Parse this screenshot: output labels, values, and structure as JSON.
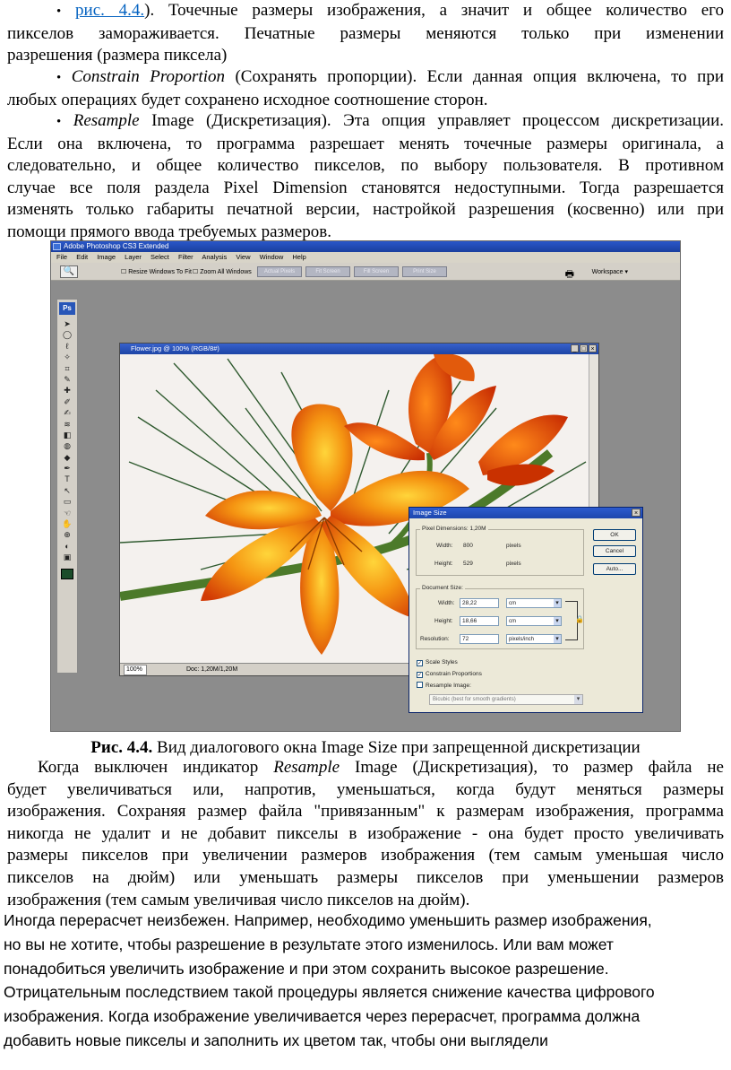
{
  "text": {
    "bullet_symbol": "•",
    "p1_link": "рис. 4.4.",
    "p1_l1_rest": "). Точечные размеры изображения, а значит и общее количество его",
    "p1_l2": "пикселов замораживается. Печатные размеры меняются только при изменении",
    "p1_l3": "разрешения (размера пиксела)",
    "p2_term": "Constrain Proportion",
    "p2_l1_rest": " (Сохранять пропорции). Если данная опция включена, то при",
    "p2_l2": "любых операциях будет сохранено исходное соотношение сторон.",
    "p3_term": "Resample",
    "p3_l1_rest": " Image (Дискретизация). Эта опция управляет процессом дискретизации.",
    "p3_l2": "Если она включена, то программа разрешает менять точечные размеры оригинала, а",
    "p3_l3": "следовательно, и общее количество пикселов, по выбору пользователя. В противном",
    "p3_l4": "случае все поля раздела Pixel Dimension становятся недоступными. Тогда разрешается",
    "p3_l5": "изменять только габариты печатной версии, настройкой разрешения (косвенно) или при",
    "p3_l6": "помощи прямого ввода требуемых размеров.",
    "caption_label": "Рис. 4.4.",
    "caption_text": " Вид диалогового окна Image Size при запрещенной дискретизации",
    "p4_l1_a": "Когда выключен индикатор ",
    "p4_term": "Resample",
    "p4_l1_b": " Image (Дискретизация), то размер файла не",
    "p4_l2": "будет увеличиваться или, напротив, уменьшаться, когда будут меняться размеры",
    "p4_l3": "изображения. Сохраняя размер файла \"привязанным\" к размерам изображения, программа",
    "p4_l4": "никогда не удалит и не добавит пикселы в изображение - она будет просто увеличивать",
    "p4_l5": "размеры пикселов при увеличении размеров изображения (тем самым уменьшая число",
    "p4_l6": "пикселов на дюйм) или уменьшать размеры пикселов при уменьшении размеров",
    "p4_l7": "изображения (тем самым увеличивая число пикселов на дюйм).",
    "p5_l1": "Иногда перерасчет неизбежен. Например, необходимо уменьшить размер изображения,",
    "p5_l2": "но вы не хотите, чтобы разрешение в результате этого изменилось. Или вам может",
    "p5_l3": "понадобиться увеличить изображение и при этом сохранить высокое разрешение.",
    "p5_l4": "Отрицательным последствием такой процедуры является снижение качества цифрового",
    "p5_l5": "изображения. Когда изображение увеличивается через перерасчет, программа должна",
    "p5_l6": "добавить новые пикселы и заполнить их цветом так, чтобы они выглядели"
  },
  "screenshot": {
    "app_title": "Adobe Photoshop CS3 Extended",
    "menu": [
      "File",
      "Edit",
      "Image",
      "Layer",
      "Select",
      "Filter",
      "Analysis",
      "View",
      "Window",
      "Help"
    ],
    "options": {
      "tool_icon": "zoom-icon",
      "resize_windows": "Resize Windows To Fit",
      "zoom_all_windows": "Zoom All Windows",
      "buttons": [
        "Actual Pixels",
        "Fit Screen",
        "Fill Screen",
        "Print Size"
      ],
      "workspace": "Workspace ▾"
    },
    "toolbox_logo": "Ps",
    "tools": [
      "➤",
      "◯",
      "ℓ",
      "✧",
      "⌗",
      "✎",
      "✚",
      "✐",
      "✍",
      "≋",
      "◧",
      "◍",
      "◆",
      "✒",
      "T",
      "↖",
      "▭",
      "☜",
      "✋",
      "⊕",
      "◐",
      "▣"
    ],
    "document": {
      "title": "Flower.jpg @ 100% (RGB/8#)",
      "zoom": "100%",
      "doc_size": "Doc: 1,20M/1,20M",
      "window_buttons": [
        "_",
        "□",
        "×"
      ]
    },
    "dialog": {
      "title": "Image Size",
      "close": "×",
      "pixel_dimensions_label": "Pixel Dimensions: 1,20M",
      "width_label": "Width:",
      "width_value": "800",
      "width_unit": "pixels",
      "height_label": "Height:",
      "height_value": "529",
      "height_unit": "pixels",
      "document_size_label": "Document Size:",
      "doc_width_label": "Width:",
      "doc_width_value": "28,22",
      "doc_width_unit": "cm",
      "doc_height_label": "Height:",
      "doc_height_value": "18,66",
      "doc_height_unit": "cm",
      "resolution_label": "Resolution:",
      "resolution_value": "72",
      "resolution_unit": "pixels/inch",
      "ok": "OK",
      "cancel": "Cancel",
      "auto": "Auto...",
      "scale_styles": "Scale Styles",
      "constrain_proportions": "Constrain Proportions",
      "resample_image": "Resample Image:",
      "resample_method": "Bicubic (best for smooth gradients)",
      "checked_mark": "✓",
      "lock_icon": "🔒"
    }
  },
  "colors": {
    "link": "#0563c1",
    "workspace_bg": "#8c8c8c",
    "title_blue": "#1f4ab0",
    "flower_orange": "#f07a10",
    "flower_red": "#d63200"
  }
}
